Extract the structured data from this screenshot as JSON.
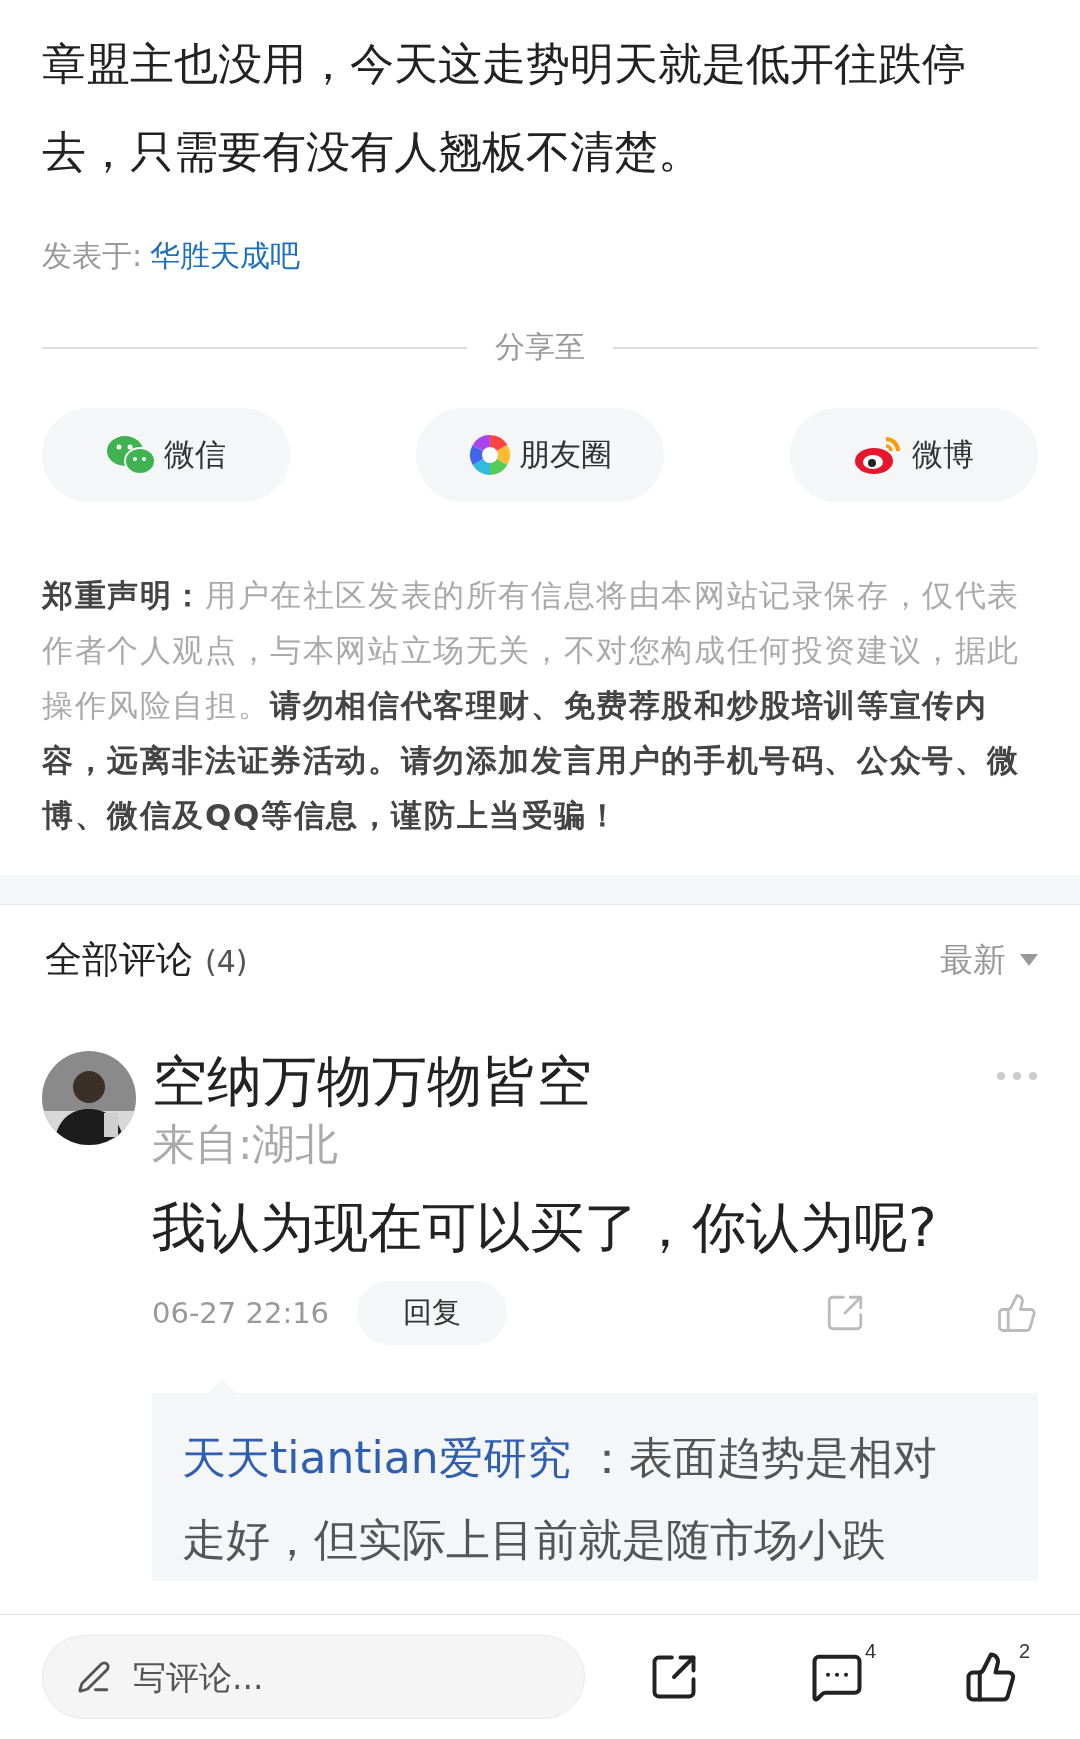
{
  "post": {
    "body": "章盟主也没用，今天这走势明天就是低开往跌停去，只需要有没有人翘板不清楚。",
    "posted_in_label": "发表于:",
    "posted_in_link": "华胜天成吧"
  },
  "share": {
    "title": "分享至",
    "targets": [
      {
        "kind": "wechat",
        "label": "微信"
      },
      {
        "kind": "moments",
        "label": "朋友圈"
      },
      {
        "kind": "weibo",
        "label": "微博"
      }
    ]
  },
  "disclaimer": {
    "title": "郑重声明：",
    "text": "用户在社区发表的所有信息将由本网站记录保存，仅代表作者个人观点，与本网站立场无关，不对您构成任何投资建议，据此操作风险自担。",
    "warning": "请勿相信代客理财、免费荐股和炒股培训等宣传内容，远离非法证券活动。请勿添加发言用户的手机号码、公众号、微博、微信及QQ等信息，谨防上当受骗！"
  },
  "comments": {
    "title": "全部评论",
    "count": "(4)",
    "sort": "最新",
    "items": [
      {
        "author": "空纳万物万物皆空",
        "location": "来自:湖北",
        "text": "我认为现在可以买了，你认为呢?",
        "time": "06-27 22:16",
        "reply_button": "回复",
        "replies": [
          {
            "author": "天天tiantian爱研究",
            "text": " ：表面趋势是相对走好，但实际上目前就是随市场小跌"
          }
        ]
      }
    ]
  },
  "bottom_bar": {
    "placeholder": "写评论...",
    "comment_count": "4",
    "like_count": "2"
  }
}
